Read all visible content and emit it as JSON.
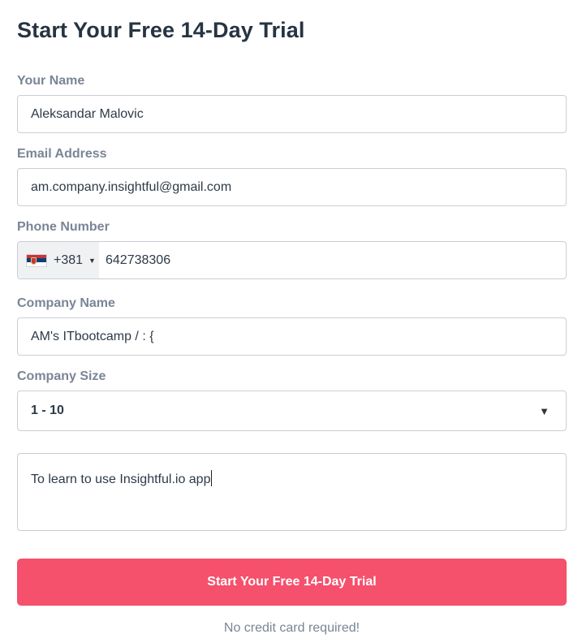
{
  "form": {
    "title": "Start Your Free 14-Day Trial",
    "name": {
      "label": "Your Name",
      "value": "Aleksandar Malovic"
    },
    "email": {
      "label": "Email Address",
      "value": "am.company.insightful@gmail.com"
    },
    "phone": {
      "label": "Phone Number",
      "country_flag": "serbia-flag-icon",
      "dial_code": "+381",
      "value": "642738306"
    },
    "company": {
      "label": "Company Name",
      "value": "AM's ITbootcamp / : {"
    },
    "company_size": {
      "label": "Company Size",
      "selected": "1 - 10"
    },
    "message": {
      "value": "To learn to use Insightful.io app"
    },
    "submit_label": "Start Your Free 14-Day Trial",
    "note": "No credit card required!"
  },
  "colors": {
    "accent": "#f5506c",
    "title": "#263442",
    "label": "#7a8596",
    "border": "#c9ced5"
  }
}
